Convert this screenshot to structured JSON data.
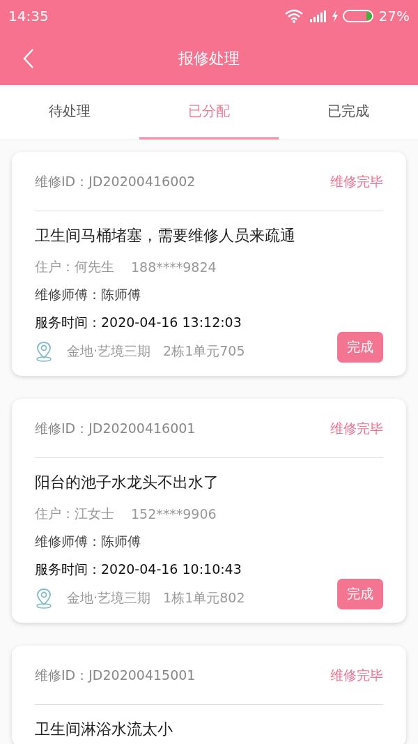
{
  "status_bar": {
    "time": "14:35",
    "battery": "27%"
  },
  "header": {
    "title": "报修处理"
  },
  "tabs": [
    {
      "label": "待处理",
      "selected": false
    },
    {
      "label": "已分配",
      "selected": true
    },
    {
      "label": "已完成",
      "selected": false
    }
  ],
  "orders": [
    {
      "id_label": "维修ID：JD20200416002",
      "status": "维修完毕",
      "title": "卫生间马桶堵塞，需要维修人员来疏通",
      "resident": "住户：何先生",
      "phone": "188****9824",
      "technician": "维修师傅：陈师傅",
      "service_time": "服务时间：2020-04-16 13:12:03",
      "community": "金地·艺境三期",
      "unit": "2栋1单元705",
      "button": "完成"
    },
    {
      "id_label": "维修ID：JD20200416001",
      "status": "维修完毕",
      "title": "阳台的池子水龙头不出水了",
      "resident": "住户：江女士",
      "phone": "152****9906",
      "technician": "维修师傅：陈师傅",
      "service_time": "服务时间：2020-04-16 10:10:43",
      "community": "金地·艺境三期",
      "unit": "1栋1单元802",
      "button": "完成"
    },
    {
      "id_label": "维修ID：JD20200415001",
      "status": "维修完毕",
      "title": "卫生间淋浴水流太小"
    }
  ]
}
